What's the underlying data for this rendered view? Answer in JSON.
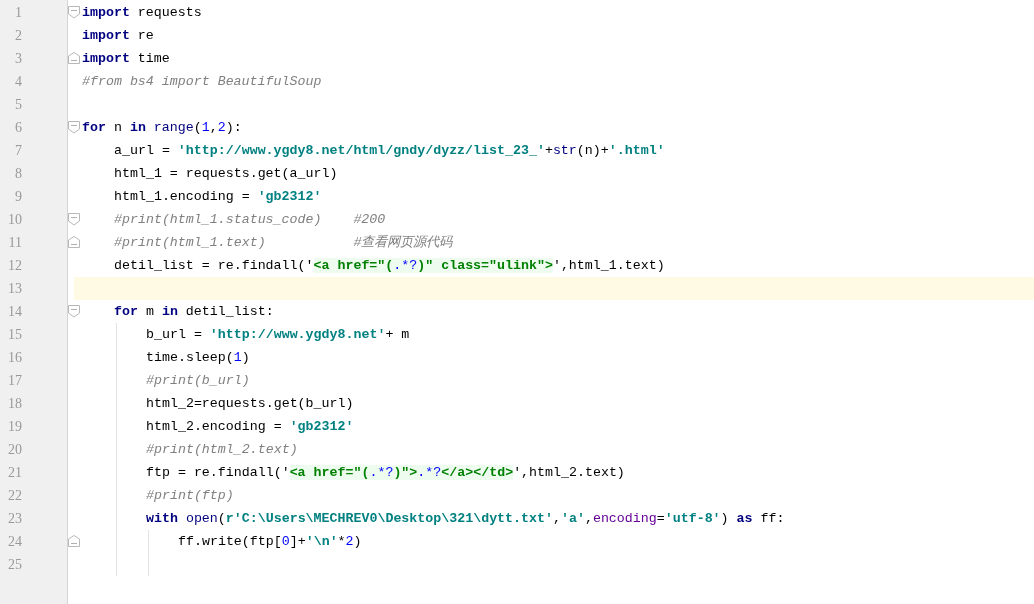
{
  "lines": [
    {
      "number": "1",
      "fold_start": true,
      "selected": false,
      "tokens": [
        {
          "kind": "keyword",
          "text": "import"
        },
        {
          "kind": "plain",
          "text": " requests"
        }
      ]
    },
    {
      "number": "2",
      "selected": false,
      "tokens": [
        {
          "kind": "keyword",
          "text": "import"
        },
        {
          "kind": "plain",
          "text": " re"
        }
      ]
    },
    {
      "number": "3",
      "fold_end": true,
      "selected": false,
      "tokens": [
        {
          "kind": "keyword",
          "text": "import"
        },
        {
          "kind": "plain",
          "text": " time"
        }
      ]
    },
    {
      "number": "4",
      "selected": false,
      "tokens": [
        {
          "kind": "comment",
          "text": "#from bs4 import BeautifulSoup"
        }
      ]
    },
    {
      "number": "5",
      "selected": false
    },
    {
      "number": "6",
      "fold_start": true,
      "selected": false,
      "tokens": [
        {
          "kind": "keyword",
          "text": "for"
        },
        {
          "kind": "plain",
          "text": " n "
        },
        {
          "kind": "keyword",
          "text": "in"
        },
        {
          "kind": "builtin",
          "text": " range"
        },
        {
          "kind": "plain",
          "text": "("
        },
        {
          "kind": "number",
          "text": "1"
        },
        {
          "kind": "plain",
          "text": ","
        },
        {
          "kind": "number",
          "text": "2"
        },
        {
          "kind": "plain",
          "text": "):"
        }
      ],
      "children": [
        {
          "number": "7",
          "selected": false,
          "tokens": [
            {
              "kind": "plain",
              "text": "a_url = "
            },
            {
              "kind": "string",
              "text": "'http://www.ygdy8.net/html/gndy/dyzz/list_23_'"
            },
            {
              "kind": "plain",
              "text": "+"
            },
            {
              "kind": "builtin",
              "text": "str"
            },
            {
              "kind": "plain",
              "text": "(n)+"
            },
            {
              "kind": "string",
              "text": "'.html'"
            }
          ]
        },
        {
          "number": "8",
          "selected": false,
          "tokens": [
            {
              "kind": "plain",
              "text": "html_1 = requests.get(a_url)"
            }
          ]
        },
        {
          "number": "9",
          "selected": false,
          "tokens": [
            {
              "kind": "plain",
              "text": "html_1.encoding = "
            },
            {
              "kind": "string",
              "text": "'gb2312'"
            }
          ]
        },
        {
          "number": "10",
          "fold_start": true,
          "selected": false,
          "tokens": [
            {
              "kind": "comment",
              "text": "#print(html_1.status_code)    #200"
            }
          ]
        },
        {
          "number": "11",
          "fold_end": true,
          "selected": false,
          "tokens": [
            {
              "kind": "comment",
              "text": "#print(html_1.text)           #查看网页源代码"
            }
          ]
        },
        {
          "number": "12",
          "selected": false,
          "tokens": [
            {
              "kind": "plain",
              "text": "detil_list = re.findall('"
            },
            {
              "kind": "regex",
              "text": "<a href=\"("
            },
            {
              "kind": "regex_meta",
              "text": ".*?"
            },
            {
              "kind": "regex",
              "text": ")\" class=\"ulink\">"
            },
            {
              "kind": "plain",
              "text": "',html_1.text)"
            }
          ]
        },
        {
          "number": "13",
          "selected": true
        },
        {
          "number": "14",
          "fold_start": true,
          "selected": false,
          "tokens": [
            {
              "kind": "keyword",
              "text": "for"
            },
            {
              "kind": "plain",
              "text": " m "
            },
            {
              "kind": "keyword",
              "text": "in"
            },
            {
              "kind": "plain",
              "text": " detil_list:"
            }
          ],
          "children": [
            {
              "number": "15",
              "selected": false,
              "tokens": [
                {
                  "kind": "plain",
                  "text": "b_url = "
                },
                {
                  "kind": "string",
                  "text": "'http://www.ygdy8.net'"
                },
                {
                  "kind": "plain",
                  "text": "+ m"
                }
              ]
            },
            {
              "number": "16",
              "selected": false,
              "tokens": [
                {
                  "kind": "plain",
                  "text": "time.sleep("
                },
                {
                  "kind": "number",
                  "text": "1"
                },
                {
                  "kind": "plain",
                  "text": ")"
                }
              ]
            },
            {
              "number": "17",
              "selected": false,
              "tokens": [
                {
                  "kind": "comment",
                  "text": "#print(b_url)"
                }
              ]
            },
            {
              "number": "18",
              "selected": false,
              "tokens": [
                {
                  "kind": "plain",
                  "text": "html_2=requests.get(b_url)"
                }
              ]
            },
            {
              "number": "19",
              "selected": false,
              "tokens": [
                {
                  "kind": "plain",
                  "text": "html_2.encoding = "
                },
                {
                  "kind": "string",
                  "text": "'gb2312'"
                }
              ]
            },
            {
              "number": "20",
              "selected": false,
              "tokens": [
                {
                  "kind": "comment",
                  "text": "#print(html_2.text)"
                }
              ]
            },
            {
              "number": "21",
              "selected": false,
              "tokens": [
                {
                  "kind": "plain",
                  "text": "ftp = re.findall('"
                },
                {
                  "kind": "regex",
                  "text": "<a href=\"("
                },
                {
                  "kind": "regex_meta",
                  "text": ".*?"
                },
                {
                  "kind": "regex",
                  "text": ")\">"
                },
                {
                  "kind": "regex_meta",
                  "text": ".*?"
                },
                {
                  "kind": "regex",
                  "text": "</a></td>"
                },
                {
                  "kind": "plain",
                  "text": "',html_2.text)"
                }
              ]
            },
            {
              "number": "22",
              "selected": false,
              "tokens": [
                {
                  "kind": "comment",
                  "text": "#print(ftp)"
                }
              ]
            },
            {
              "number": "23",
              "selected": false,
              "tokens": [
                {
                  "kind": "keyword",
                  "text": "with"
                },
                {
                  "kind": "builtin",
                  "text": " open"
                },
                {
                  "kind": "plain",
                  "text": "("
                },
                {
                  "kind": "string",
                  "text": "r'C:\\Users\\MECHREV0\\Desktop\\321\\dytt.txt'"
                },
                {
                  "kind": "plain",
                  "text": ","
                },
                {
                  "kind": "string",
                  "text": "'a'"
                },
                {
                  "kind": "plain",
                  "text": ","
                },
                {
                  "kind": "param",
                  "text": "encoding"
                },
                {
                  "kind": "plain",
                  "text": "="
                },
                {
                  "kind": "string",
                  "text": "'utf-8'"
                },
                {
                  "kind": "plain",
                  "text": ") "
                },
                {
                  "kind": "keyword",
                  "text": "as"
                },
                {
                  "kind": "plain",
                  "text": " ff:"
                }
              ],
              "children": [
                {
                  "number": "24",
                  "fold_end": true,
                  "selected": false,
                  "tokens": [
                    {
                      "kind": "plain",
                      "text": "ff.write(ftp["
                    },
                    {
                      "kind": "number",
                      "text": "0"
                    },
                    {
                      "kind": "plain",
                      "text": "]+"
                    },
                    {
                      "kind": "string",
                      "text": "'\\n'"
                    },
                    {
                      "kind": "plain",
                      "text": "*"
                    },
                    {
                      "kind": "number",
                      "text": "2"
                    },
                    {
                      "kind": "plain",
                      "text": ")"
                    }
                  ]
                },
                {
                  "number": "25",
                  "selected": false
                }
              ]
            }
          ]
        }
      ]
    }
  ]
}
